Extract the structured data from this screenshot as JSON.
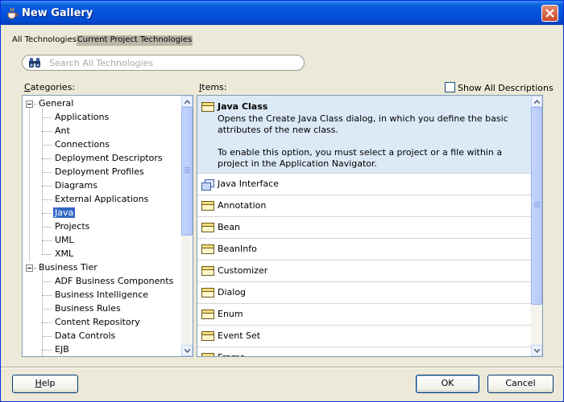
{
  "window": {
    "title": "New Gallery"
  },
  "tech_tabs": {
    "all": "All Technologies",
    "current": "Current Project Technologies"
  },
  "search": {
    "placeholder": "Search All Technologies",
    "value": ""
  },
  "categories": {
    "label_accel": "C",
    "label_rest": "ategories:",
    "tree": [
      {
        "label": "General",
        "level": 0,
        "expanded": true
      },
      {
        "label": "Applications",
        "level": 1
      },
      {
        "label": "Ant",
        "level": 1
      },
      {
        "label": "Connections",
        "level": 1
      },
      {
        "label": "Deployment Descriptors",
        "level": 1
      },
      {
        "label": "Deployment Profiles",
        "level": 1
      },
      {
        "label": "Diagrams",
        "level": 1
      },
      {
        "label": "External Applications",
        "level": 1
      },
      {
        "label": "Java",
        "level": 1,
        "selected": true
      },
      {
        "label": "Projects",
        "level": 1
      },
      {
        "label": "UML",
        "level": 1
      },
      {
        "label": "XML",
        "level": 1
      },
      {
        "label": "Business Tier",
        "level": 0,
        "expanded": true
      },
      {
        "label": "ADF Business Components",
        "level": 1
      },
      {
        "label": "Business Intelligence",
        "level": 1
      },
      {
        "label": "Business Rules",
        "level": 1
      },
      {
        "label": "Content Repository",
        "level": 1
      },
      {
        "label": "Data Controls",
        "level": 1
      },
      {
        "label": "EJB",
        "level": 1
      }
    ]
  },
  "items": {
    "label_accel": "I",
    "label_rest": "tems:",
    "show_all_descriptions": "Show All Descriptions",
    "selected": {
      "name": "Java Class",
      "description_1": "Opens the Create Java Class dialog, in which you define the basic attributes of the new class.",
      "description_2": "To enable this option, you must select a project or a file within a project in the Application Navigator."
    },
    "list": [
      "Java Interface",
      "Annotation",
      "Bean",
      "BeanInfo",
      "Customizer",
      "Dialog",
      "Enum",
      "Event Set",
      "Frame"
    ]
  },
  "buttons": {
    "help_accel": "H",
    "help_rest": "elp",
    "ok": "OK",
    "cancel": "Cancel"
  },
  "colors": {
    "titlebar": "#0454e0",
    "selection": "#316ac5",
    "selected_item_bg": "#dce9f6"
  }
}
